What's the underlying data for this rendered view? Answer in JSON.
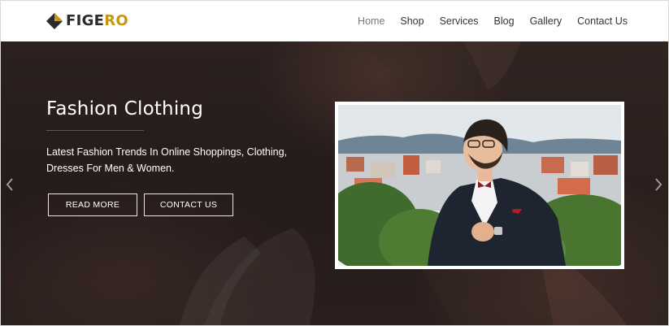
{
  "header": {
    "logo": {
      "text_dark": "FIGE",
      "text_accent": "RO",
      "icon": "diamond-logo-icon",
      "accent_color": "#c8960c"
    },
    "nav": [
      {
        "label": "Home",
        "active": true
      },
      {
        "label": "Shop"
      },
      {
        "label": "Services"
      },
      {
        "label": "Blog"
      },
      {
        "label": "Gallery"
      },
      {
        "label": "Contact Us"
      }
    ]
  },
  "hero": {
    "title": "Fashion Clothing",
    "subtitle": "Latest Fashion Trends In Online Shoppings, Clothing, Dresses For Men & Women.",
    "buttons": {
      "read_more": "READ MORE",
      "contact_us": "CONTACT US"
    },
    "prev_icon": "chevron-left-icon",
    "next_icon": "chevron-right-icon"
  }
}
